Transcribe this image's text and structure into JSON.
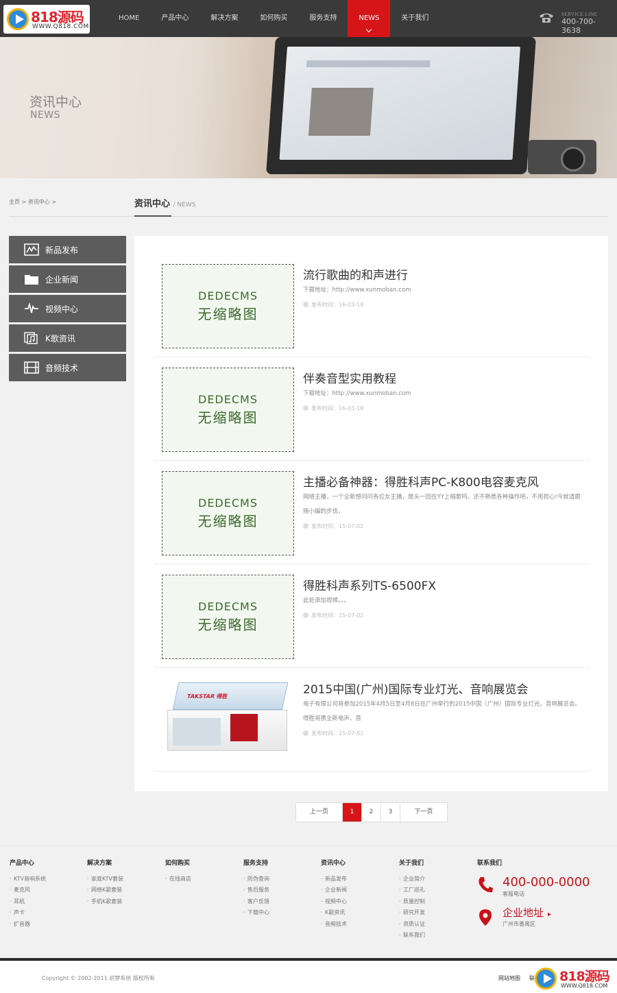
{
  "header": {
    "logo_text": "818源码",
    "logo_url": "WWW.Q818.COM",
    "nav": [
      {
        "label": "HOME"
      },
      {
        "label": "产品中心"
      },
      {
        "label": "解决方案"
      },
      {
        "label": "如何购买"
      },
      {
        "label": "服务支持"
      },
      {
        "label": "NEWS",
        "active": true
      },
      {
        "label": "关于我们"
      }
    ],
    "service_label": "SERVICE LINE",
    "service_phone": "400-700-3638"
  },
  "banner": {
    "title": "资讯中心",
    "subtitle": "NEWS"
  },
  "breadcrumb": "主页 > 资讯中心 >",
  "section": {
    "title": "资讯中心",
    "sep_en": "/ NEWS"
  },
  "sidebar": {
    "items": [
      {
        "label": "新品发布",
        "icon": "chart-icon"
      },
      {
        "label": "企业新闻",
        "icon": "folder-icon"
      },
      {
        "label": "视频中心",
        "icon": "pulse-icon"
      },
      {
        "label": "K歌资讯",
        "icon": "music-icon"
      },
      {
        "label": "音频技术",
        "icon": "film-icon"
      }
    ]
  },
  "placeholder": {
    "line1": "DEDECMS",
    "line2": "无缩略图"
  },
  "articles": [
    {
      "title": "流行歌曲的和声进行",
      "desc": "下载地址：http://www.xunmoban.com",
      "date": "发布时间：16-03-18"
    },
    {
      "title": "伴奏音型实用教程",
      "desc": "下载地址：http://www.xunmoban.com",
      "date": "发布时间：16-03-18"
    },
    {
      "title": "主播必备神器：得胜科声PC-K800电容麦克风",
      "desc": "网络主播，一个全新想问问各位女主播，是头一回在YY上唱歌吗，还不熟悉各种操作吧，不用担心!今就请跟随小编的步伐，",
      "date": "发布时间：15-07-02"
    },
    {
      "title": "得胜科声系列TS-6500FX",
      "desc": "此处添加视频。。。",
      "date": "发布时间：15-07-02"
    },
    {
      "title": "2015中国(广州)国际专业灯光、音响展览会",
      "desc": "电子有限公司将参加2015年4月5日至4月8日在广州举行的2015中国（广州）国际专业灯光、音响展览会。得胜将携全新电声、音",
      "date": "发布时间：15-07-02",
      "booth_logo": "TAKSTAR 得胜"
    }
  ],
  "pagination": {
    "prev": "上一页",
    "pages": [
      "1",
      "2",
      "3"
    ],
    "current": "1",
    "next": "下一页"
  },
  "footer": {
    "columns": [
      {
        "title": "产品中心",
        "items": [
          "KTV音响系统",
          "麦克风",
          "耳机",
          "声卡",
          "扩音器"
        ]
      },
      {
        "title": "解决方案",
        "items": [
          "家庭KTV套装",
          "网络K歌套装",
          "手机K歌套装"
        ]
      },
      {
        "title": "如何购买",
        "items": [
          "在线商店"
        ]
      },
      {
        "title": "服务支持",
        "items": [
          "防伪查询",
          "售后服务",
          "客户反馈",
          "下载中心"
        ]
      },
      {
        "title": "资讯中心",
        "items": [
          "新品发布",
          "企业新闻",
          "视频中心",
          "K歌资讯",
          "音频技术"
        ]
      },
      {
        "title": "关于我们",
        "items": [
          "企业简介",
          "工厂巡礼",
          "质量控制",
          "研究开发",
          "资质认证",
          "联系我们"
        ]
      }
    ],
    "contact": {
      "title": "联系我们",
      "phone": "400-000-0000",
      "phone_sub": "客服电话",
      "address": "企业地址",
      "address_sub": "广州市番禺区"
    },
    "copyright": "Copyright © 2002-2011 织梦系统 版权所有",
    "sitemap": "网站地图",
    "link2": "联",
    "watermark_text": "818源码",
    "watermark_url": "WWW.Q818.COM"
  },
  "colors": {
    "accent": "#d61518",
    "header_bg": "#3a3a3a",
    "sidebar_bg": "#5c5c5c",
    "contact_red": "#c8121a"
  }
}
